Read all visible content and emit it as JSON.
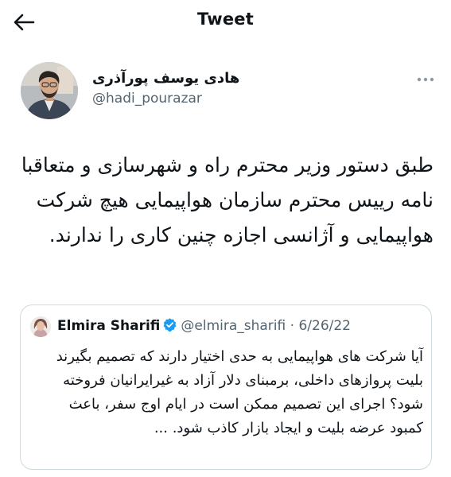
{
  "header": {
    "title": "Tweet",
    "back_icon": "arrow-left-icon"
  },
  "tweet": {
    "author_name": "هادی یوسف پورآذری",
    "author_handle": "@hadi_pourazar",
    "text": "طبق دستور وزیر محترم راه و شهرسازی و متعاقبا نامه رییس محترم سازمان هواپیمایی هیچ شرکت هواپیمایی و آژانسی اجازه چنین کاری را ندارند.",
    "more_icon": "more-horizontal-icon"
  },
  "quoted_tweet": {
    "author_name": "Elmira Sharifi",
    "author_handle": "@elmira_sharifi",
    "separator": "·",
    "date": "6/26/22",
    "verified_icon": "verified-badge-icon",
    "verified_color": "#1d9bf0",
    "text": "آیا شرکت های هواپیمایی به حدی اختیار دارند که تصمیم بگیرند بلیت پروازهای داخلی، برمبنای دلار آزاد به غیرایرانیان فروخته شود؟ اجرای این تصمیم ممکن است در ایام اوج سفر، باعث کمبود عرضه بلیت و ایجاد بازار کاذب شود. ..."
  }
}
